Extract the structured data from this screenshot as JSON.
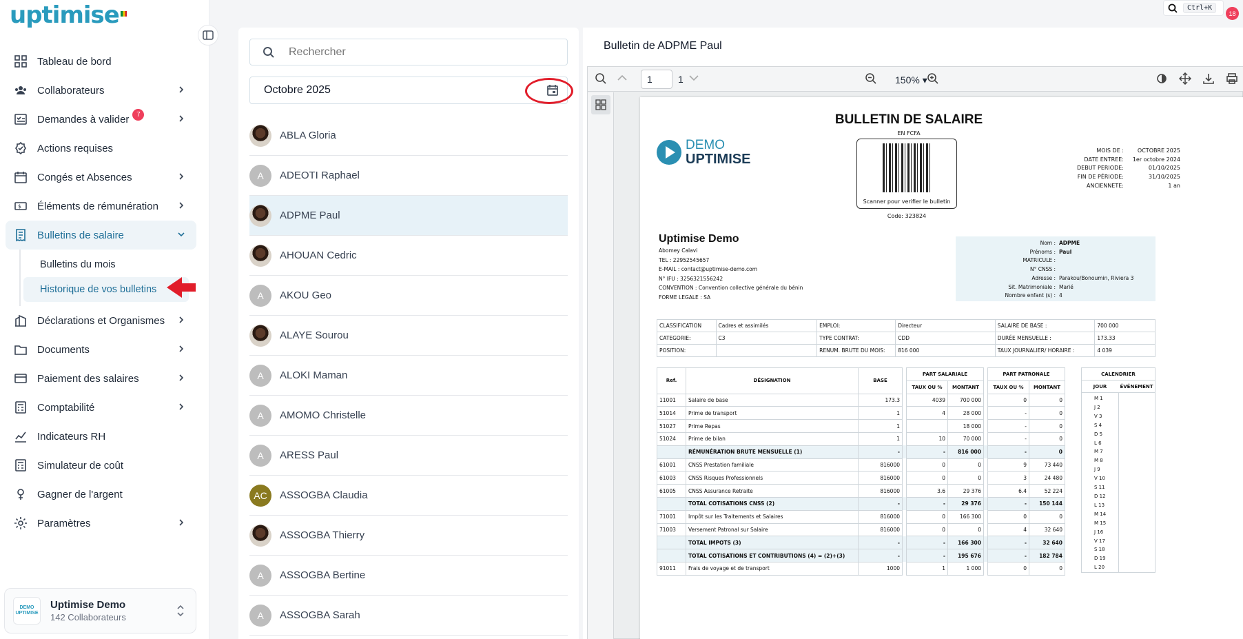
{
  "app": {
    "logo_text": "uptimise"
  },
  "sidebar": {
    "items": [
      {
        "label": "Tableau de bord"
      },
      {
        "label": "Collaborateurs"
      },
      {
        "label": "Demandes à valider",
        "badge": "7"
      },
      {
        "label": "Actions requises"
      },
      {
        "label": "Congés et Absences"
      },
      {
        "label": "Éléments de rémunération"
      },
      {
        "label": "Bulletins de salaire"
      },
      {
        "label": "Déclarations et Organismes"
      },
      {
        "label": "Documents"
      },
      {
        "label": "Paiement des salaires"
      },
      {
        "label": "Comptabilité"
      },
      {
        "label": "Indicateurs RH"
      },
      {
        "label": "Simulateur de coût"
      },
      {
        "label": "Gagner de l'argent"
      },
      {
        "label": "Paramètres"
      }
    ],
    "subitems": [
      {
        "label": "Bulletins du mois"
      },
      {
        "label": "Historique de vos bulletins"
      }
    ],
    "org": {
      "logo": "DEMO UPTIMISE",
      "name": "Uptimise Demo",
      "count": "142 Collaborateurs"
    }
  },
  "topbar": {
    "shortcut": "Ctrl+K",
    "notifications": "18"
  },
  "list": {
    "search_placeholder": "Rechercher",
    "month": "Octobre 2025",
    "employees": [
      {
        "name": "ABLA Gloria",
        "initials": ""
      },
      {
        "name": "ADEOTI Raphael",
        "initials": "A"
      },
      {
        "name": "ADPME Paul",
        "initials": ""
      },
      {
        "name": "AHOUAN Cedric",
        "initials": ""
      },
      {
        "name": "AKOU Geo",
        "initials": "A"
      },
      {
        "name": "ALAYE Sourou",
        "initials": ""
      },
      {
        "name": "ALOKI Maman",
        "initials": "A"
      },
      {
        "name": "AMOMO Christelle",
        "initials": "A"
      },
      {
        "name": "ARESS Paul",
        "initials": "A"
      },
      {
        "name": "ASSOGBA Claudia",
        "initials": "AC"
      },
      {
        "name": "ASSOGBA Thierry",
        "initials": ""
      },
      {
        "name": "ASSOGBA Bertine",
        "initials": "A"
      },
      {
        "name": "ASSOGBA Sarah",
        "initials": "A"
      }
    ]
  },
  "viewer": {
    "title": "Bulletin de ADPME Paul",
    "page_current": "1",
    "page_total": "1",
    "zoom": "150%"
  },
  "doc": {
    "title": "BULLETIN DE SALAIRE",
    "currency": "EN FCFA",
    "qr_text": "Scanner pour verifier le bulletin",
    "code": "Code: 323824",
    "brand_1": "DEMO",
    "brand_2": "UPTIMISE",
    "meta": [
      {
        "k": "MOIS DE :",
        "v": "OCTOBRE 2025"
      },
      {
        "k": "DATE ENTREE:",
        "v": "1er octobre 2024"
      },
      {
        "k": "DEBUT PERIODE:",
        "v": "01/10/2025"
      },
      {
        "k": "FIN DE PÉRIODE:",
        "v": "31/10/2025"
      },
      {
        "k": "ANCIENNETE:",
        "v": "1 an"
      }
    ],
    "company": {
      "name": "Uptimise Demo",
      "lines": [
        "Abomey Calavi",
        "TEL : 22952545657",
        "E-MAIL : contact@uptimise-demo.com",
        "N° IFU : 3256321556242",
        "CONVENTION : Convention collective générale du bénin",
        "FORME LEGALE : SA"
      ]
    },
    "employee": [
      {
        "k": "Nom :",
        "v": "ADPME"
      },
      {
        "k": "Prénoms :",
        "v": "Paul"
      },
      {
        "k": "MATRICULE :",
        "v": ""
      },
      {
        "k": "N° CNSS :",
        "v": ""
      },
      {
        "k": "Adresse :",
        "v": "Parakou/Bonoumin, Riviera 3"
      },
      {
        "k": "Sit. Matrimoniale :",
        "v": "Marié"
      },
      {
        "k": "Nombre enfant (s) :",
        "v": "4"
      }
    ],
    "info": [
      [
        "CLASSIFICATION",
        "Cadres et assimilés",
        "EMPLOI:",
        "Directeur",
        "SALAIRE DE BASE :",
        "700 000"
      ],
      [
        "CATEGORIE:",
        "C3",
        "TYPE CONTRAT:",
        "CDD",
        "DURÉE MENSUELLE :",
        "173.33"
      ],
      [
        "POSITION:",
        "",
        "RENUM. BRUTE DU MOIS:",
        "816 000",
        "TAUX JOURNALIER/ HORAIRE :",
        "4 039"
      ]
    ],
    "pay_headers": {
      "ref": "Ref.",
      "des": "DÉSIGNATION",
      "base": "BASE",
      "sal": "PART SALARIALE",
      "pat": "PART PATRONALE",
      "taux": "TAUX OU %",
      "montant": "MONTANT",
      "cal": "CALENDRIER",
      "jour": "JOUR",
      "event": "ÉVÉNEMENT"
    },
    "pay_rows": [
      {
        "ref": "11001",
        "des": "Salaire de base",
        "base": "173.3",
        "st": "4039",
        "sm": "700 000",
        "pt": "0",
        "pm": "0",
        "tot": false
      },
      {
        "ref": "51014",
        "des": "Prime de transport",
        "base": "1",
        "st": "4",
        "sm": "28 000",
        "pt": "-",
        "pm": "0",
        "tot": false
      },
      {
        "ref": "51027",
        "des": "Prime Repas",
        "base": "1",
        "st": "",
        "sm": "18 000",
        "pt": "-",
        "pm": "0",
        "tot": false
      },
      {
        "ref": "51024",
        "des": "Prime de bilan",
        "base": "1",
        "st": "10",
        "sm": "70 000",
        "pt": "-",
        "pm": "0",
        "tot": false
      },
      {
        "ref": "",
        "des": "RÉMUNÉRATION BRUTE MENSUELLE (1)",
        "base": "-",
        "st": "-",
        "sm": "816 000",
        "pt": "-",
        "pm": "0",
        "tot": true
      },
      {
        "ref": "61001",
        "des": "CNSS Prestation familiale",
        "base": "816000",
        "st": "0",
        "sm": "0",
        "pt": "9",
        "pm": "73 440",
        "tot": false
      },
      {
        "ref": "61003",
        "des": "CNSS Risques Professionnels",
        "base": "816000",
        "st": "0",
        "sm": "0",
        "pt": "3",
        "pm": "24 480",
        "tot": false
      },
      {
        "ref": "61005",
        "des": "CNSS Assurance Retraite",
        "base": "816000",
        "st": "3.6",
        "sm": "29 376",
        "pt": "6.4",
        "pm": "52 224",
        "tot": false
      },
      {
        "ref": "",
        "des": "TOTAL COTISATIONS CNSS (2)",
        "base": "-",
        "st": "-",
        "sm": "29 376",
        "pt": "-",
        "pm": "150 144",
        "tot": true
      },
      {
        "ref": "71001",
        "des": "Impôt sur les Traitements et Salaires",
        "base": "816000",
        "st": "0",
        "sm": "166 300",
        "pt": "0",
        "pm": "0",
        "tot": false
      },
      {
        "ref": "71003",
        "des": "Versement Patronal sur Salaire",
        "base": "816000",
        "st": "0",
        "sm": "0",
        "pt": "4",
        "pm": "32 640",
        "tot": false
      },
      {
        "ref": "",
        "des": "TOTAL IMPOTS (3)",
        "base": "-",
        "st": "-",
        "sm": "166 300",
        "pt": "-",
        "pm": "32 640",
        "tot": true
      },
      {
        "ref": "",
        "des": "TOTAL COTISATIONS ET CONTRIBUTIONS (4) = (2)+(3)",
        "base": "-",
        "st": "-",
        "sm": "195 676",
        "pt": "-",
        "pm": "182 784",
        "tot": true
      },
      {
        "ref": "91011",
        "des": "Frais de voyage et de transport",
        "base": "1000",
        "st": "1",
        "sm": "1 000",
        "pt": "0",
        "pm": "0",
        "tot": false
      }
    ],
    "days": [
      "M 1",
      "J 2",
      "V 3",
      "S 4",
      "D 5",
      "L 6",
      "M 7",
      "M 8",
      "J 9",
      "V 10",
      "S 11",
      "D 12",
      "L 13",
      "M 14",
      "M 15",
      "J 16",
      "V 17",
      "S 18",
      "D 19",
      "L 20"
    ]
  }
}
